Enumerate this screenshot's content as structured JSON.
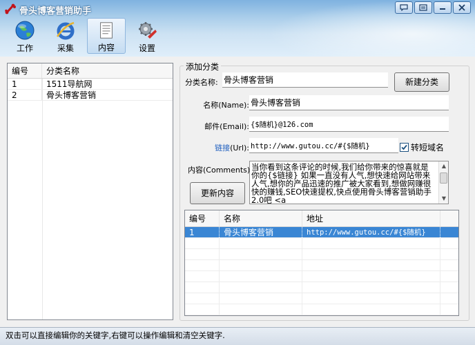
{
  "app": {
    "title": "骨头博客营销助手"
  },
  "toolbar": {
    "items": [
      {
        "label": "工作",
        "icon": "globe-icon"
      },
      {
        "label": "采集",
        "icon": "ie-icon"
      },
      {
        "label": "内容",
        "icon": "document-icon"
      },
      {
        "label": "设置",
        "icon": "tools-gear-icon"
      }
    ],
    "active": "内容"
  },
  "category_list": {
    "headers": [
      "编号",
      "分类名称"
    ],
    "rows": [
      {
        "no": "1",
        "name": "1511导航网"
      },
      {
        "no": "2",
        "name": "骨头博客营销"
      }
    ]
  },
  "form": {
    "group_title": "添加分类",
    "category_label": "分类名称:",
    "category_value": "骨头博客营销",
    "new_button": "新建分类",
    "name_label": "名称(Name):",
    "name_value": "骨头博客营销",
    "email_label": "邮件(Email):",
    "email_value": "{$随机}@126.com",
    "url_label_link": "链接",
    "url_label_rest": "(Url):",
    "url_value": "http://www.gutou.cc/#{$随机}",
    "shorten_label": "转短域名",
    "shorten_checked": true,
    "content_label": "内容(Comments):",
    "content_value": "当你看到这条评论的时候,我们给你带来的惊喜就是 你的{$链接} 如果一直没有人气,想快速给网站带来人气,想你的产品迅速的推广被大家看到,想做网赚很快的赚钱,SEO快速提权,快点使用骨头博客营销助手2.0吧 <a",
    "update_button": "更新内容"
  },
  "content_grid": {
    "headers": [
      "编号",
      "名称",
      "地址"
    ],
    "rows": [
      {
        "no": "1",
        "name": "骨头博客营销",
        "url": "http://www.gutou.cc/#{$随机}",
        "selected": true
      }
    ]
  },
  "status": {
    "text": "双击可以直接编辑你的关键字,右键可以操作编辑和清空关键字."
  },
  "colors": {
    "selection": "#3a86d4",
    "link": "#1f5fbf",
    "title_bar": "#7fb2e0"
  }
}
